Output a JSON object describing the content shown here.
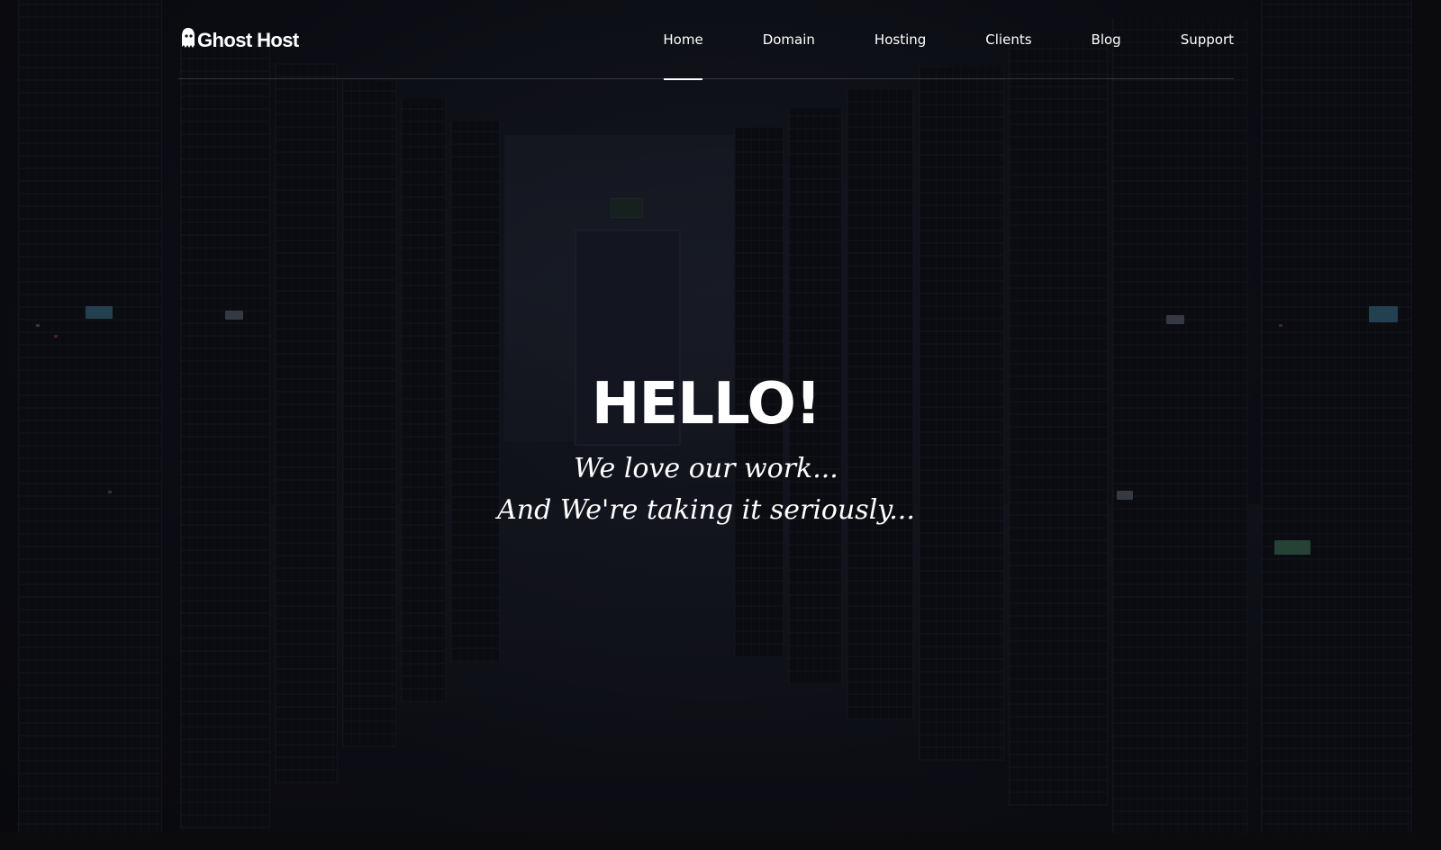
{
  "brand": {
    "name": "Ghost Host",
    "icon": "ghost-icon"
  },
  "nav": {
    "items": [
      {
        "label": "Home",
        "active": true
      },
      {
        "label": "Domain",
        "active": false
      },
      {
        "label": "Hosting",
        "active": false
      },
      {
        "label": "Clients",
        "active": false
      },
      {
        "label": "Blog",
        "active": false
      },
      {
        "label": "Support",
        "active": false
      }
    ]
  },
  "hero": {
    "title": "HELLO!",
    "line1": "We love our work...",
    "line2": "And We're taking it seriously..."
  },
  "colors": {
    "text": "#ffffff",
    "background": "#0e1018",
    "divider": "rgba(255,255,255,0.16)"
  }
}
